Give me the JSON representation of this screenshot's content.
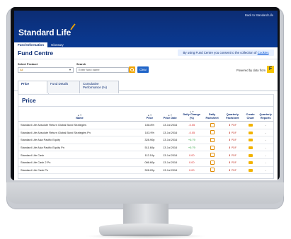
{
  "header": {
    "back_link": "Back to Standard Life",
    "logo": "Standard Life",
    "nav": [
      "Fund Information",
      "Glossary"
    ]
  },
  "fund_centre": {
    "title": "Fund Centre",
    "consent_text": "By using Fund Centre you consent to the collection of",
    "consent_link": "Cookies"
  },
  "filters": {
    "select_product_label": "Select Product",
    "select_product_value": "All",
    "search_label": "Search",
    "search_placeholder": "Enter fund name",
    "clear_label": "Clear",
    "powered_by": "Powered by data from",
    "powered_logo": "F"
  },
  "content_tabs": [
    "Price",
    "Fund Details",
    "Cumulative Performance (%)"
  ],
  "price_panel": {
    "title": "Price",
    "columns": [
      "Name",
      "Price",
      "Price Date",
      "Daily Change (%)",
      "Daily Factsheet",
      "Quarterly Factsheet",
      "Create Chart",
      "Quarterly Reports"
    ],
    "pdf_label": "PDF",
    "dash": "-",
    "rows": [
      {
        "name": "Standard Life Absolute Return Global Bond Strategies",
        "price": "108.8%",
        "date": "13 Jul 2016",
        "change": "-0.05",
        "dir": "dn"
      },
      {
        "name": "Standard Life Absolute Return Global Bond Strategies Pn",
        "price": "103.9%",
        "date": "13 Jul 2016",
        "change": "-0.05",
        "dir": "dn"
      },
      {
        "name": "Standard Life Asia Pacific Equity",
        "price": "328.90p",
        "date": "13 Jul 2016",
        "change": "+0.79",
        "dir": "up"
      },
      {
        "name": "Standard Life Asia Pacific Equity Pn",
        "price": "511.60p",
        "date": "13 Jul 2016",
        "change": "+0.79",
        "dir": "up"
      },
      {
        "name": "Standard Life Cash",
        "price": "112.10p",
        "date": "13 Jul 2016",
        "change": "0.00",
        "dir": "dn"
      },
      {
        "name": "Standard Life Cash 2 Pn",
        "price": "086.60p",
        "date": "13 Jul 2016",
        "change": "0.00",
        "dir": "dn"
      },
      {
        "name": "Standard Life Cash Pn",
        "price": "328.20p",
        "date": "13 Jul 2016",
        "change": "0.00",
        "dir": "dn"
      }
    ]
  },
  "colors": {
    "brand_blue": "#0c2d74",
    "accent_orange": "#f0a400",
    "up_green": "#1f9a2f",
    "down_red": "#d92b2b"
  }
}
